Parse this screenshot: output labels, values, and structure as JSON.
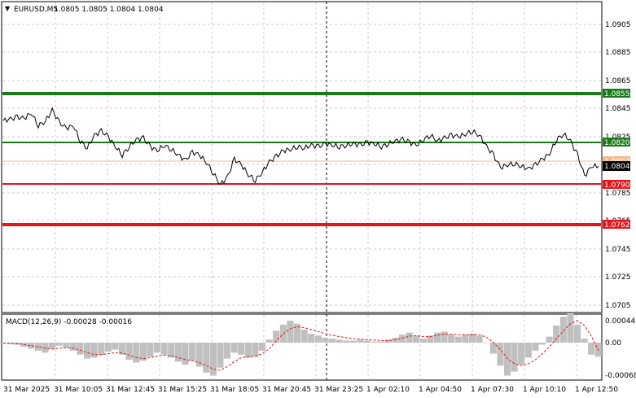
{
  "header": {
    "menu_arrow": "▼",
    "symbol": "EURUSD,M5",
    "ohlc": "1.0805 1.0805 1.0804 1.0804"
  },
  "price_axis": {
    "ticks": [
      "1.0905",
      "1.0885",
      "1.0865",
      "1.0845",
      "1.0825",
      "1.0785",
      "1.0765",
      "1.0745",
      "1.0725",
      "1.0705"
    ]
  },
  "levels": [
    {
      "label": "1.0855",
      "color": "#1a7a1a"
    },
    {
      "label": "1.0820",
      "color": "#1a7a1a"
    },
    {
      "label": "1.0790",
      "color": "#e8141c"
    },
    {
      "label": "1.0762",
      "color": "#e8141c"
    }
  ],
  "current_price": {
    "label": "1.0804",
    "bid_tag": "1.0807"
  },
  "macd": {
    "title": "MACD(12,26,9) -0.00028 -0.00016",
    "ticks": [
      "0.00044",
      "0.00",
      "-0.00068"
    ]
  },
  "time_axis": {
    "ticks": [
      "31 Mar 2025",
      "31 Mar 10:05",
      "31 Mar 12:45",
      "31 Mar 15:25",
      "31 Mar 18:05",
      "31 Mar 20:45",
      "31 Mar 23:25",
      "1 Apr 02:10",
      "1 Apr 04:50",
      "1 Apr 07:30",
      "1 Apr 10:10",
      "1 Apr 12:50"
    ]
  },
  "chart_data": {
    "type": "line",
    "symbol": "EURUSD",
    "timeframe": "M5",
    "price_series": [
      1.08365,
      1.08375,
      1.0839,
      1.0838,
      1.0842,
      1.0833,
      1.0836,
      1.0844,
      1.0835,
      1.0831,
      1.0833,
      1.0822,
      1.0817,
      1.0826,
      1.0829,
      1.0825,
      1.0818,
      1.0812,
      1.0818,
      1.0823,
      1.0824,
      1.0818,
      1.0815,
      1.0819,
      1.0816,
      1.0812,
      1.0808,
      1.0814,
      1.0812,
      1.0807,
      1.0799,
      1.0791,
      1.0796,
      1.0809,
      1.0805,
      1.0798,
      1.0794,
      1.08,
      1.0807,
      1.0811,
      1.0815,
      1.0816,
      1.0818,
      1.0817,
      1.0819,
      1.0818,
      1.082,
      1.0819,
      1.0818,
      1.0819,
      1.082,
      1.0819,
      1.0821,
      1.082,
      1.0818,
      1.082,
      1.0822,
      1.0823,
      1.0821,
      1.0819,
      1.0823,
      1.0826,
      1.0822,
      1.0824,
      1.0826,
      1.0825,
      1.0827,
      1.0829,
      1.0826,
      1.0818,
      1.0812,
      1.0803,
      1.0805,
      1.0806,
      1.0804,
      1.0802,
      1.0805,
      1.0809,
      1.0813,
      1.0823,
      1.0827,
      1.0822,
      1.0812,
      1.0797,
      1.0804,
      1.0804
    ],
    "macd_histogram": [
      -2e-05,
      -3e-05,
      -4e-05,
      -8e-05,
      -0.00012,
      -0.00016,
      -0.0002,
      -0.00012,
      -6e-05,
      -0.0001,
      -0.00016,
      -0.00024,
      -0.00032,
      -0.0003,
      -0.00024,
      -0.00018,
      -0.00014,
      -0.00024,
      -0.00034,
      -0.0004,
      -0.00036,
      -0.00028,
      -0.0002,
      -0.00024,
      -0.0003,
      -0.00038,
      -0.00044,
      -0.00036,
      -0.00048,
      -0.0006,
      -0.00066,
      -0.0005,
      -0.00032,
      -0.0002,
      -0.00024,
      -0.0003,
      -0.00028,
      -0.00016,
      6e-05,
      0.00024,
      0.00036,
      0.00044,
      0.00038,
      0.00026,
      0.00018,
      0.00014,
      0.0001,
      8e-05,
      6e-05,
      4e-05,
      4e-05,
      6e-05,
      4e-05,
      2e-05,
      2e-05,
      6e-05,
      0.0001,
      0.00016,
      0.0002,
      0.00014,
      8e-05,
      0.00014,
      0.0002,
      0.00022,
      0.00016,
      0.00012,
      0.00016,
      0.00018,
      0.00014,
      0.0,
      -0.00022,
      -0.00046,
      -0.00066,
      -0.00058,
      -0.00044,
      -0.0003,
      -0.00016,
      -4e-05,
      0.00012,
      0.00034,
      0.00052,
      0.00058,
      0.00036,
      8e-05,
      -0.00024,
      -0.00028
    ],
    "macd_signal": [
      -1e-05,
      -1e-05,
      -2e-05,
      -4e-05,
      -6e-05,
      -8e-05,
      -0.00011,
      -0.00013,
      -0.00011,
      -0.0001,
      -0.00011,
      -0.00015,
      -0.0002,
      -0.00024,
      -0.00024,
      -0.00022,
      -0.0002,
      -0.00021,
      -0.00025,
      -0.0003,
      -0.00032,
      -0.0003,
      -0.00027,
      -0.00025,
      -0.00026,
      -0.0003,
      -0.00034,
      -0.00036,
      -0.0004,
      -0.00046,
      -0.00053,
      -0.00055,
      -0.00048,
      -0.00038,
      -0.0003,
      -0.00028,
      -0.00027,
      -0.00022,
      -0.00012,
      4e-05,
      0.00018,
      0.00028,
      0.00032,
      0.0003,
      0.00026,
      0.00022,
      0.00018,
      0.00015,
      0.00012,
      0.0001,
      8e-05,
      7e-05,
      6e-05,
      5e-05,
      4e-05,
      4e-05,
      6e-05,
      9e-05,
      0.00013,
      0.00014,
      0.00012,
      0.00012,
      0.00015,
      0.00017,
      0.00017,
      0.00016,
      0.00016,
      0.00016,
      0.00016,
      0.00011,
      0.0,
      -0.00014,
      -0.00032,
      -0.00042,
      -0.00046,
      -0.00042,
      -0.00034,
      -0.00022,
      -8e-05,
      8e-05,
      0.00024,
      0.00038,
      0.00044,
      0.00034,
      0.00012,
      -0.00016
    ]
  },
  "colors": {
    "grid": "#c8cdd4",
    "price_line": "#000000",
    "support_green": "#1a7a1a",
    "resistance_red": "#e8141c",
    "bid_line": "#f0b98c",
    "macd_hist": "#c0c0c0",
    "macd_signal": "#e8141c"
  }
}
